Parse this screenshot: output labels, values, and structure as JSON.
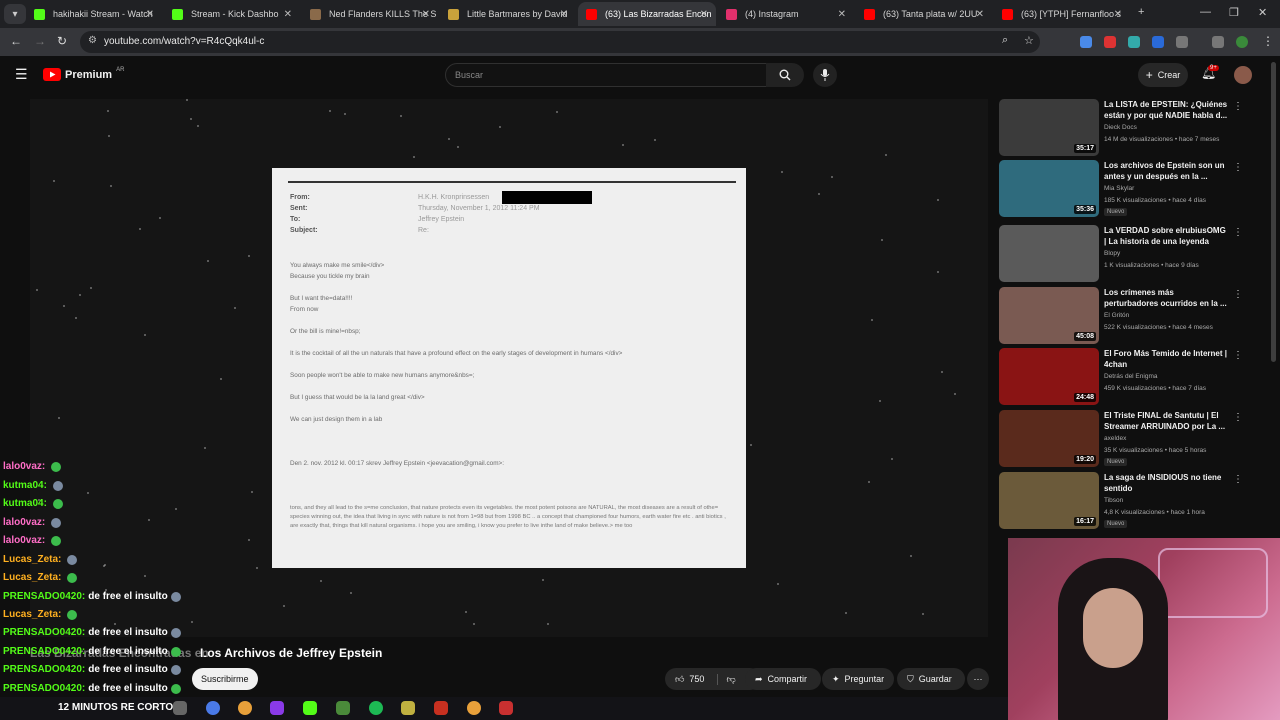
{
  "browser": {
    "tabs": [
      {
        "label": "hakihakii Stream - Watch",
        "color": "#53fc18"
      },
      {
        "label": "Stream - Kick Dashbo",
        "color": "#53fc18"
      },
      {
        "label": "Ned Flanders KILLS The S",
        "color": "#8a6a4a"
      },
      {
        "label": "Little Bartmares by David",
        "color": "#c9a23b"
      },
      {
        "label": "(63) Las Bizarradas Encon",
        "color": "#ff0000"
      },
      {
        "label": "(4) Instagram",
        "color": "#e1306c"
      },
      {
        "label": "(63) Tanta plata w/ 2UU",
        "color": "#ff0000"
      },
      {
        "label": "(63) [YTPH] Fernanfloo s",
        "color": "#ff0000"
      }
    ],
    "url": "youtube.com/watch?v=R4cQqk4ul-c"
  },
  "youtube": {
    "logo_text": "Premium",
    "region": "AR",
    "search_placeholder": "Buscar",
    "create_label": "Crear",
    "notif_count": "9+"
  },
  "document": {
    "labels": [
      "From:",
      "Sent:",
      "To:",
      "Subject:"
    ],
    "values": [
      "H.K.H. Kronprinsessen",
      "Thursday, November 1, 2012 11:24 PM",
      "Jeffrey Epstein",
      "Re:"
    ],
    "lines": [
      "You always make me smile</div>",
      "Because you tickle my brain",
      "But I want the=data!!!!",
      "From now",
      "Or the bill is mine!=nbsp;",
      "It is the cocktail of all the un naturals that have a profound effect on the early stages of development in humans </div>",
      "Soon people won't be able to make new humans anymore&nbs=;",
      "But I guess that would be la la land great </div>",
      "We can just design them in a lab",
      "Den 2. nov. 2012 kl. 00:17 skrev Jeffrey Epstein <jeevacation@gmail.com>:"
    ],
    "fine": "tons, and they all lead to the s=me conclusion, that nature protects even its vegetables.   the most potent poisons are NATURAL, the most diseases are a result of othe= species winning out, the idea that living in sync with nature is not from 1=98 but from 1998 BC  .. a concept that championed four humors, earth water fire etc .   anti biotics , are exactly that, things that kill natural organisms.     i hope you are smiling,   i know you prefer to live inthe land of make believe.>  me too"
  },
  "video": {
    "title_overlay_a": "Las Bizarradas Encontradas en",
    "title_overlay_b": "Los Archivos de Jeffrey Epstein",
    "subscribe": "Suscribirme",
    "likes": "750",
    "share": "Compartir",
    "ask": "Preguntar",
    "save": "Guardar",
    "taskbar_text": "12 MINUTOS RE CORTO"
  },
  "chat": [
    {
      "user": "lalo0vaz:",
      "msg": "",
      "color": "#ff6ec7"
    },
    {
      "user": "kutma04:",
      "msg": "",
      "color": "#53fc18"
    },
    {
      "user": "kutma04:",
      "msg": "",
      "color": "#53fc18"
    },
    {
      "user": "lalo0vaz:",
      "msg": "",
      "color": "#ff6ec7"
    },
    {
      "user": "lalo0vaz:",
      "msg": "",
      "color": "#ff6ec7"
    },
    {
      "user": "Lucas_Zeta:",
      "msg": "",
      "color": "#ffb020"
    },
    {
      "user": "Lucas_Zeta:",
      "msg": "",
      "color": "#ffb020"
    },
    {
      "user": "PRENSADO0420:",
      "msg": "de free el insulto",
      "color": "#53fc18"
    },
    {
      "user": "Lucas_Zeta:",
      "msg": "",
      "color": "#ffb020"
    },
    {
      "user": "PRENSADO0420:",
      "msg": "de free el insulto",
      "color": "#53fc18"
    },
    {
      "user": "PRENSADO0420:",
      "msg": "de free el insulto",
      "color": "#53fc18"
    },
    {
      "user": "PRENSADO0420:",
      "msg": "de free el insulto",
      "color": "#53fc18"
    },
    {
      "user": "PRENSADO0420:",
      "msg": "de free el insulto",
      "color": "#53fc18"
    }
  ],
  "sidebar": [
    {
      "title": "La LISTA de EPSTEIN: ¿Quiénes están y por qué NADIE habla d...",
      "channel": "Dieck Docs",
      "meta": "14 M de visualizaciones • hace 7 meses",
      "duration": "35:17",
      "badge": "",
      "thumb": "#3b3b3b"
    },
    {
      "title": "Los archivos de Epstein son un antes y un después en la ...",
      "channel": "Mia Skylar",
      "meta": "185 K visualizaciones • hace 4 días",
      "duration": "35:36",
      "badge": "Nuevo",
      "thumb": "#2f6b7d"
    },
    {
      "title": "La VERDAD sobre elrubiusOMG | La historia de una leyenda",
      "channel": "Blopy",
      "meta": "1 K visualizaciones • hace 9 días",
      "duration": "",
      "badge": "",
      "thumb": "#5a5a5a"
    },
    {
      "title": "Los crímenes más perturbadores ocurridos en la ...",
      "channel": "El Gritón",
      "meta": "522 K visualizaciones • hace 4 meses",
      "duration": "45:08",
      "badge": "",
      "thumb": "#7a5a52"
    },
    {
      "title": "El Foro Más Temido de Internet | 4chan",
      "channel": "Detrás del Enigma",
      "meta": "459 K visualizaciones • hace 7 días",
      "duration": "24:48",
      "badge": "",
      "thumb": "#8a1414"
    },
    {
      "title": "El Triste FINAL de Santutu | El Streamer ARRUINADO por La ...",
      "channel": "axeldex",
      "meta": "35 K visualizaciones • hace 5 horas",
      "duration": "19:20",
      "badge": "Nuevo",
      "thumb": "#5a2a1c"
    },
    {
      "title": "La saga de INSIDIOUS no tiene sentido",
      "channel": "Tibson",
      "meta": "4,8 K visualizaciones • hace 1 hora",
      "duration": "16:17",
      "badge": "Nuevo",
      "thumb": "#6b5a3a"
    }
  ]
}
